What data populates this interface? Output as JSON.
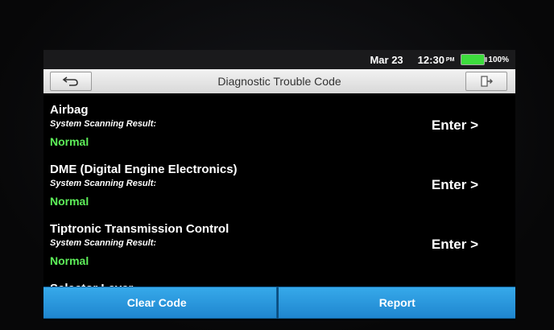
{
  "statusbar": {
    "date": "Mar 23",
    "time": "12:30",
    "ampm": "PM",
    "battery": "100%",
    "battery_color": "#3ddc3d"
  },
  "titlebar": {
    "title": "Diagnostic Trouble Code",
    "back_icon": "back-arrow-icon",
    "exit_icon": "exit-icon"
  },
  "systems": [
    {
      "name": "Airbag",
      "subtitle": "System Scanning Result:",
      "status": "Normal",
      "action": "Enter >"
    },
    {
      "name": "DME (Digital Engine Electronics)",
      "subtitle": "System Scanning Result:",
      "status": "Normal",
      "action": "Enter >"
    },
    {
      "name": "Tiptronic Transmission Control",
      "subtitle": "System Scanning Result:",
      "status": "Normal",
      "action": "Enter >"
    },
    {
      "name": "Selector Lever"
    }
  ],
  "buttons": {
    "clear_code": "Clear Code",
    "report": "Report",
    "accent_color": "#2a9ae0"
  },
  "status_color": "#5ef05a"
}
